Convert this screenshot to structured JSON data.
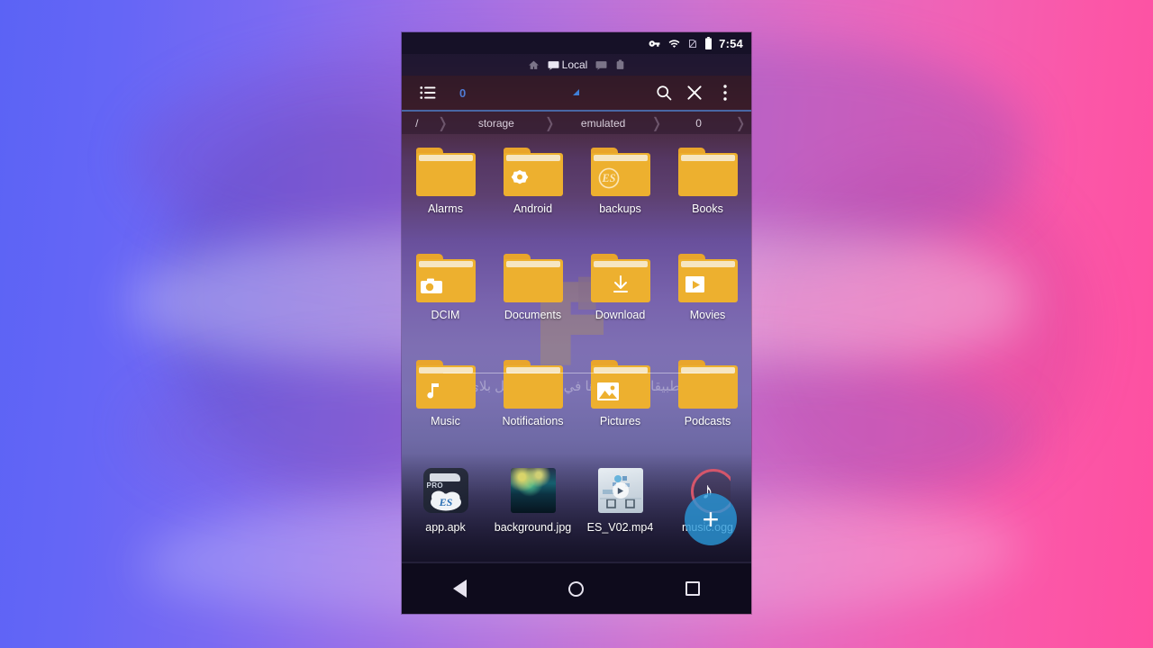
{
  "device": {
    "statusbar": {
      "icons": [
        "vpn-key-icon",
        "wifi-icon",
        "sim-off-icon",
        "battery-icon"
      ],
      "time": "7:54"
    },
    "navbar": {
      "back_label": "Back",
      "home_label": "Home",
      "recents_label": "Recents"
    }
  },
  "app": {
    "tabs": {
      "home_icon": "home-icon",
      "items": [
        {
          "label": "Local",
          "icon": "window-icon",
          "active": true
        },
        {
          "label": "",
          "icon": "window-icon",
          "active": false
        },
        {
          "label": "",
          "icon": "window-icon",
          "active": false
        }
      ]
    },
    "toolbar": {
      "view_mode_icon": "list-view-icon",
      "selection_count": "0",
      "search_icon": "search-icon",
      "close_icon": "close-icon",
      "overflow_icon": "more-vertical-icon"
    },
    "breadcrumb": {
      "root": "/",
      "segments": [
        "storage",
        "emulated",
        "0"
      ],
      "chevron": "›"
    },
    "fab": {
      "label": "+",
      "name": "add-button",
      "color": "#2997d8"
    },
    "watermark": {
      "text": "تطبيقات لن تجدها في متجر جوجل بلاي",
      "logo": "arabic-site-logo"
    },
    "grid": {
      "items": [
        {
          "name": "Alarms",
          "type": "folder",
          "glyph": "none"
        },
        {
          "name": "Android",
          "type": "folder",
          "glyph": "android-gear"
        },
        {
          "name": "backups",
          "type": "folder",
          "glyph": "es-logo"
        },
        {
          "name": "Books",
          "type": "folder",
          "glyph": "none"
        },
        {
          "name": "DCIM",
          "type": "folder",
          "glyph": "camera"
        },
        {
          "name": "Documents",
          "type": "folder",
          "glyph": "none"
        },
        {
          "name": "Download",
          "type": "folder",
          "glyph": "download-arrow"
        },
        {
          "name": "Movies",
          "type": "folder",
          "glyph": "play-box"
        },
        {
          "name": "Music",
          "type": "folder",
          "glyph": "music-note"
        },
        {
          "name": "Notifications",
          "type": "folder",
          "glyph": "none"
        },
        {
          "name": "Pictures",
          "type": "folder",
          "glyph": "image"
        },
        {
          "name": "Podcasts",
          "type": "folder",
          "glyph": "none"
        },
        {
          "name": "app.apk",
          "type": "apk",
          "glyph": "es-file-explorer-pro",
          "badge": "PRO"
        },
        {
          "name": "background.jpg",
          "type": "image",
          "glyph": "photo-thumbnail"
        },
        {
          "name": "ES_V02.mp4",
          "type": "video",
          "glyph": "video-thumbnail"
        },
        {
          "name": "music.ogg",
          "type": "audio",
          "glyph": "music-note-circle"
        }
      ]
    }
  },
  "colors": {
    "folder": "#edb02f",
    "folder_tab": "#e9a52b",
    "accent_blue": "#4f7bd4",
    "fab_blue": "#2997d8",
    "audio_red": "#d4566b",
    "bg_start": "#5b63f5",
    "bg_end": "#fe4fa0"
  }
}
